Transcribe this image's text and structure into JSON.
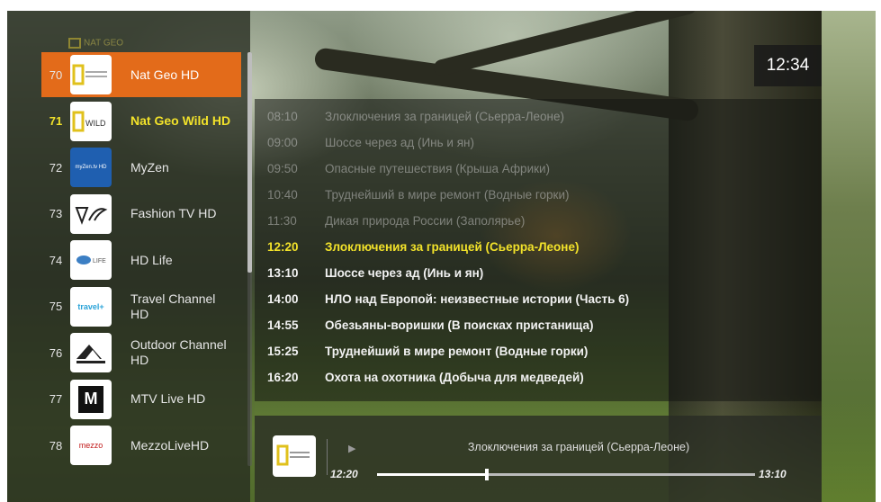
{
  "clock": "12:34",
  "faint_label": "NAT GEO",
  "channels": [
    {
      "num": "70",
      "name": "Nat Geo HD",
      "logo": "natgeo",
      "state": "selected"
    },
    {
      "num": "71",
      "name": "Nat Geo Wild HD",
      "logo": "natgeo-wild",
      "state": "current"
    },
    {
      "num": "72",
      "name": "MyZen",
      "logo": "myzen",
      "state": ""
    },
    {
      "num": "73",
      "name": "Fashion TV HD",
      "logo": "fashiontv",
      "state": ""
    },
    {
      "num": "74",
      "name": "HD Life",
      "logo": "hdlife",
      "state": ""
    },
    {
      "num": "75",
      "name": "Travel Channel HD",
      "logo": "travel",
      "state": ""
    },
    {
      "num": "76",
      "name": "Outdoor Channel HD",
      "logo": "outdoor",
      "state": ""
    },
    {
      "num": "77",
      "name": "MTV Live HD",
      "logo": "mtv",
      "state": ""
    },
    {
      "num": "78",
      "name": "MezzoLiveHD",
      "logo": "mezzo",
      "state": ""
    }
  ],
  "logo_text": {
    "natgeo": "NATIONAL GEOGRAPHIC",
    "natgeo_wild": "WILD",
    "myzen": "myZen.tv HD",
    "hdlife": "LIFE",
    "travel": "travel+",
    "outdoor": "OUTDOOR",
    "mtv": "M",
    "mezzo": "mezzo"
  },
  "schedule": [
    {
      "time": "08:10",
      "title": "Злоключения за границей (Сьерра-Леоне)",
      "state": "past"
    },
    {
      "time": "09:00",
      "title": "Шоссе через ад (Инь и ян)",
      "state": "past"
    },
    {
      "time": "09:50",
      "title": "Опасные путешествия (Крыша Африки)",
      "state": "past"
    },
    {
      "time": "10:40",
      "title": "Труднейший в мире ремонт (Водные горки)",
      "state": "past"
    },
    {
      "time": "11:30",
      "title": "Дикая природа России (Заполярье)",
      "state": "past"
    },
    {
      "time": "12:20",
      "title": "Злоключения за границей (Сьерра-Леоне)",
      "state": "now"
    },
    {
      "time": "13:10",
      "title": "Шоссе через ад (Инь и ян)",
      "state": "fut"
    },
    {
      "time": "14:00",
      "title": "НЛО над Европой: неизвестные истории (Часть 6)",
      "state": "fut"
    },
    {
      "time": "14:55",
      "title": "Обезьяны-воришки (В поисках пристанища)",
      "state": "fut"
    },
    {
      "time": "15:25",
      "title": "Труднейший в мире ремонт (Водные горки)",
      "state": "fut"
    },
    {
      "time": "16:20",
      "title": "Охота на охотника (Добыча для медведей)",
      "state": "fut"
    }
  ],
  "now_playing": {
    "title": "Злоключения за границей (Сьерра-Леоне)",
    "start": "12:20",
    "end": "13:10",
    "progress": 0.29
  },
  "colors": {
    "accent": "#e36b1a",
    "highlight": "#f2e22a"
  }
}
